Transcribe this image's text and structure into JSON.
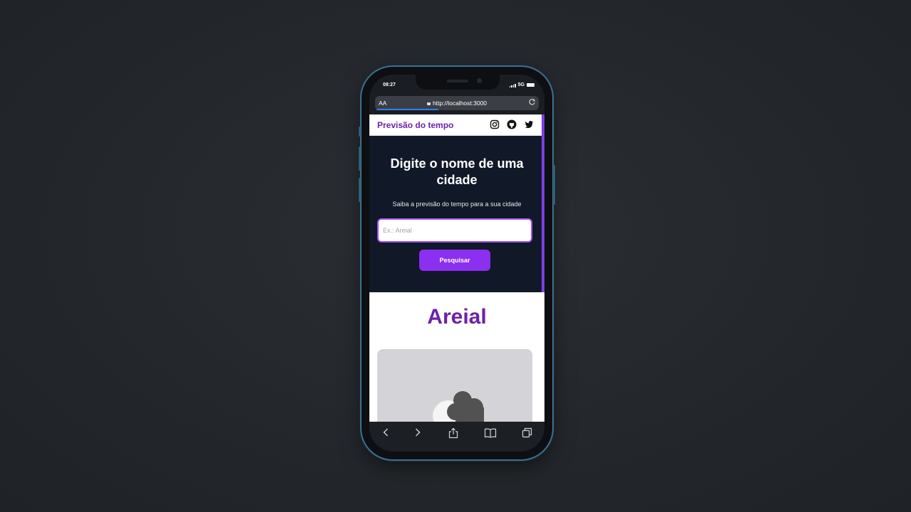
{
  "status_bar": {
    "time": "08:27",
    "network": "5G"
  },
  "browser": {
    "text_size_label": "AA",
    "url": "http://localhost:3000",
    "load_progress": 0.38,
    "toolbar_icons": [
      "back-icon",
      "forward-icon",
      "share-icon",
      "bookmarks-icon",
      "tabs-icon"
    ]
  },
  "navbar": {
    "brand": "Previsão do tempo",
    "social_icons": [
      "instagram-icon",
      "github-icon",
      "twitter-icon"
    ]
  },
  "hero": {
    "title": "Digite o nome de uma cidade",
    "subtitle": "Saiba a previsão do tempo para a sua cidade",
    "search_placeholder": "Ex.: Areial",
    "search_button": "Pesquisar"
  },
  "result": {
    "city": "Areial",
    "weather_icon": "partly-cloudy-icon"
  },
  "colors": {
    "accent": "#8b2ff0",
    "brand": "#6b21a8",
    "hero_bg": "#111827",
    "card_bg": "#d4d4d8"
  }
}
